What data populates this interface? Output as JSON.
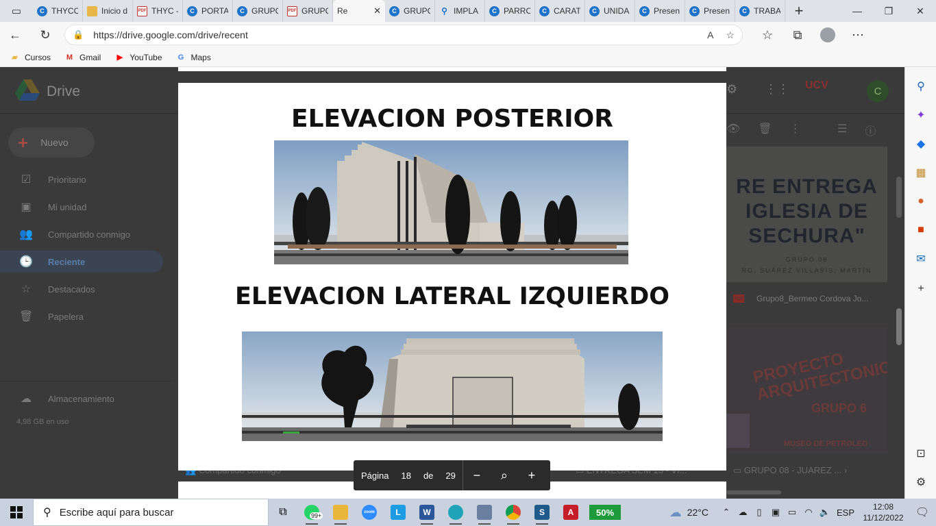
{
  "browser": {
    "tabs": [
      {
        "label": "THYCO",
        "icon": "c"
      },
      {
        "label": "Inicio d",
        "icon": "note"
      },
      {
        "label": "THYC -",
        "icon": "pdf"
      },
      {
        "label": "PORTA",
        "icon": "c"
      },
      {
        "label": "GRUPO",
        "icon": "c"
      },
      {
        "label": "GRUPO",
        "icon": "pdf"
      },
      {
        "label": "Re",
        "icon": "drive",
        "active": true
      },
      {
        "label": "GRUPO",
        "icon": "c"
      },
      {
        "label": "IMPLA",
        "icon": "search"
      },
      {
        "label": "PARRO",
        "icon": "c"
      },
      {
        "label": "CARAT",
        "icon": "c"
      },
      {
        "label": "UNIDA",
        "icon": "c"
      },
      {
        "label": "Presen",
        "icon": "c"
      },
      {
        "label": "Presen",
        "icon": "c"
      },
      {
        "label": "TRABA",
        "icon": "c"
      }
    ],
    "url": "https://drive.google.com/drive/recent",
    "bookmarks": [
      {
        "label": "Cursos",
        "color": "#e9b64a"
      },
      {
        "label": "Gmail",
        "color": "#d93025"
      },
      {
        "label": "YouTube",
        "color": "#ff0000"
      },
      {
        "label": "Maps",
        "color": "#4285f4"
      }
    ]
  },
  "drive": {
    "title": "Drive",
    "new_label": "Nuevo",
    "nav": [
      {
        "label": "Prioritario",
        "icon": "☑"
      },
      {
        "label": "Mi unidad",
        "icon": "▣"
      },
      {
        "label": "Compartido conmigo",
        "icon": "👥"
      },
      {
        "label": "Reciente",
        "icon": "🕒",
        "active": true
      },
      {
        "label": "Destacados",
        "icon": "☆"
      },
      {
        "label": "Papelera",
        "icon": "🗑"
      }
    ],
    "storage_label": "Almacenamiento",
    "storage_used": "4,98 GB en uso",
    "user_initial": "C",
    "ucv_label": "UCV",
    "thumb1_lines": [
      "RE ENTREGA",
      "IGLESIA DE",
      "SECHURA\""
    ],
    "thumb1_small": [
      "GRUPO 08",
      "RO, SUÁREZ VILLASIS, MARTÍN"
    ],
    "file1_name": "Grupo8_Bermeo Cordova Jo...",
    "thumb2_title": "PROYECTO ARQUITECTONICO",
    "thumb2_group": "GRUPO 6",
    "thumb2_museum": "MUSEO DE PETROLEO",
    "crumb_shared": "Compartido conmigo",
    "crumb_entrega": "ENTREGA SEM 13 - VI...",
    "crumb_grupo": "GRUPO 08 - JUAREZ ..."
  },
  "viewer": {
    "title1": "ELEVACION POSTERIOR",
    "title2": "ELEVACION LATERAL IZQUIERDO",
    "page_label": "Página",
    "page_current": "18",
    "page_of": "de",
    "page_total": "29"
  },
  "taskbar": {
    "search_placeholder": "Escribe aquí para buscar",
    "whatsapp_badge": "99+",
    "battery": "50%",
    "temperature": "22°C",
    "language": "ESP",
    "time": "12:08",
    "date": "11/12/2022"
  }
}
